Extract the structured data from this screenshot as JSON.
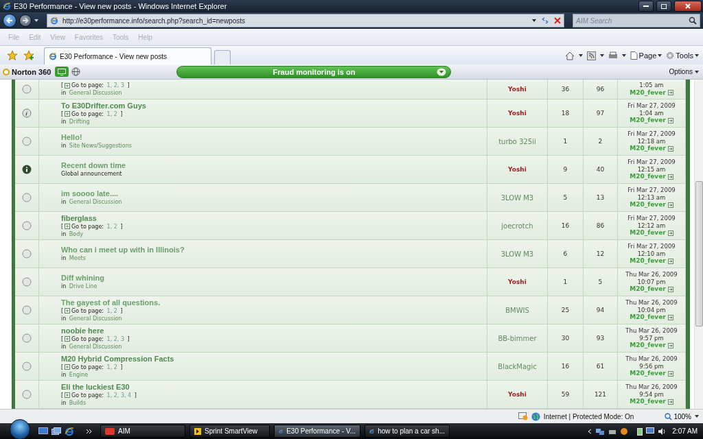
{
  "window": {
    "title": "E30 Performance - View new posts - Windows Internet Explorer"
  },
  "address_bar": {
    "url": "http://e30performance.info/search.php?search_id=newposts"
  },
  "search": {
    "placeholder": "AIM Search"
  },
  "menu": [
    {
      "label": "File",
      "disabled": true
    },
    {
      "label": "Edit",
      "disabled": true
    },
    {
      "label": "View",
      "disabled": true
    },
    {
      "label": "Favorites",
      "disabled": true
    },
    {
      "label": "Tools",
      "disabled": true
    },
    {
      "label": "Help",
      "disabled": true
    }
  ],
  "tabs": [
    {
      "label": "E30 Performance - View new posts",
      "selected": true
    }
  ],
  "command_bar": [
    {
      "label": "Page",
      "kind": "page"
    },
    {
      "label": "Tools",
      "kind": "tools"
    }
  ],
  "norton": {
    "brand": "Norton 360",
    "status": "Fraud monitoring is on",
    "options": "Options"
  },
  "topics": [
    {
      "kind": "read",
      "pager": {
        "open": "[",
        "label": "Go to page:",
        "pages": "1, 2, 3",
        "close": "]"
      },
      "forum_prefix": "in",
      "forum": "General Discussion",
      "author": "Yoshi",
      "color": "#9a1c1c",
      "replies": "36",
      "views": "96",
      "last_post": {
        "time": "1:05 am",
        "by": "M20_fever"
      }
    },
    {
      "kind": "sticky",
      "title": "To E30Drifter.com Guys",
      "visited": false,
      "pager": {
        "open": "[",
        "label": "Go to page:",
        "pages": "1, 2",
        "close": "]"
      },
      "forum_prefix": "in",
      "forum": "Drifting",
      "author": "Yoshi",
      "color": "#9a1c1c",
      "replies": "18",
      "views": "97",
      "last_post": {
        "date": "Fri Mar 27, 2009",
        "time": "1:04 am",
        "by": "M20_fever"
      }
    },
    {
      "kind": "read",
      "title": "Hello!",
      "visited": true,
      "forum_prefix": "in",
      "forum": "Site News/Suggestions",
      "author": "turbo 325ii",
      "color": "#5e8a5e",
      "replies": "1",
      "views": "2",
      "last_post": {
        "date": "Fri Mar 27, 2009",
        "time": "12:18 am",
        "by": "M20_fever"
      }
    },
    {
      "kind": "announcement",
      "title": "Recent down time",
      "visited": true,
      "note": "Global announcement",
      "author": "Yoshi",
      "color": "#9a1c1c",
      "replies": "9",
      "views": "40",
      "last_post": {
        "date": "Fri Mar 27, 2009",
        "time": "12:15 am",
        "by": "M20_fever"
      }
    },
    {
      "kind": "read",
      "title": "im soooo late....",
      "visited": true,
      "forum_prefix": "in",
      "forum": "General Discussion",
      "author": "3LOW M3",
      "color": "#5e8a5e",
      "replies": "5",
      "views": "13",
      "last_post": {
        "date": "Fri Mar 27, 2009",
        "time": "12:13 am",
        "by": "M20_fever"
      }
    },
    {
      "kind": "read",
      "title": "fiberglass",
      "visited": false,
      "pager": {
        "open": "[",
        "label": "Go to page:",
        "pages": "1, 2",
        "close": "]"
      },
      "forum_prefix": "in",
      "forum": "Body",
      "author": "joecrotch",
      "color": "#5e8a5e",
      "replies": "16",
      "views": "86",
      "last_post": {
        "date": "Fri Mar 27, 2009",
        "time": "12:12 am",
        "by": "M20_fever"
      }
    },
    {
      "kind": "read",
      "title": "Who can i meet up with in Illinois?",
      "visited": true,
      "forum_prefix": "in",
      "forum": "Meets",
      "author": "3LOW M3",
      "color": "#5e8a5e",
      "replies": "6",
      "views": "12",
      "last_post": {
        "date": "Fri Mar 27, 2009",
        "time": "12:10 am",
        "by": "M20_fever"
      }
    },
    {
      "kind": "read",
      "title": "Diff whining",
      "visited": true,
      "forum_prefix": "in",
      "forum": "Drive Line",
      "author": "Yoshi",
      "color": "#9a1c1c",
      "replies": "1",
      "views": "5",
      "last_post": {
        "date": "Thu Mar 26, 2009",
        "time": "10:07 pm",
        "by": "M20_fever"
      }
    },
    {
      "kind": "read",
      "title": "The gayest of all questions.",
      "visited": true,
      "pager": {
        "open": "[",
        "label": "Go to page:",
        "pages": "1, 2",
        "close": "]"
      },
      "forum_prefix": "in",
      "forum": "General Discussion",
      "author": "BMWIS",
      "color": "#5e8a5e",
      "replies": "25",
      "views": "94",
      "last_post": {
        "date": "Thu Mar 26, 2009",
        "time": "10:04 pm",
        "by": "M20_fever"
      }
    },
    {
      "kind": "read",
      "title": "noobie here",
      "visited": false,
      "pager": {
        "open": "[",
        "label": "Go to page:",
        "pages": "1, 2, 3",
        "close": "]"
      },
      "forum_prefix": "in",
      "forum": "General Discussion",
      "author": "BB-bimmer",
      "color": "#5e8a5e",
      "replies": "30",
      "views": "93",
      "last_post": {
        "date": "Thu Mar 26, 2009",
        "time": "9:57 pm",
        "by": "M20_fever"
      }
    },
    {
      "kind": "read",
      "title": "M20 Hybrid Compression Facts",
      "visited": false,
      "pager": {
        "open": "[",
        "label": "Go to page:",
        "pages": "1, 2",
        "close": "]"
      },
      "forum_prefix": "in",
      "forum": "Engine",
      "author": "BlackMagic",
      "color": "#5e8a5e",
      "replies": "16",
      "views": "61",
      "last_post": {
        "date": "Thu Mar 26, 2009",
        "time": "9:56 pm",
        "by": "M20_fever"
      }
    },
    {
      "kind": "read",
      "title": "Eli the luckiest E30",
      "visited": false,
      "pager": {
        "open": "[",
        "label": "Go to page:",
        "pages": "1, 2, 3, 4",
        "close": "]"
      },
      "forum_prefix": "in",
      "forum": "Builds",
      "author": "Yoshi",
      "color": "#9a1c1c",
      "replies": "59",
      "views": "121",
      "last_post": {
        "date": "Thu Mar 26, 2009",
        "time": "9:54 pm",
        "by": "M20_fever"
      }
    }
  ],
  "status_bar": {
    "zone": "Internet | Protected Mode: On",
    "zoom": "100%"
  },
  "taskbar": {
    "buttons": [
      {
        "label": "AIM",
        "kind": "aim",
        "selected": false
      },
      {
        "label": "Sprint SmartView",
        "kind": "sprint",
        "selected": false
      },
      {
        "label": "E30 Performance - V...",
        "kind": "ie",
        "selected": true
      },
      {
        "label": "how to plan a car sh...",
        "kind": "ie",
        "selected": false
      }
    ],
    "clock": "2:07 AM"
  }
}
